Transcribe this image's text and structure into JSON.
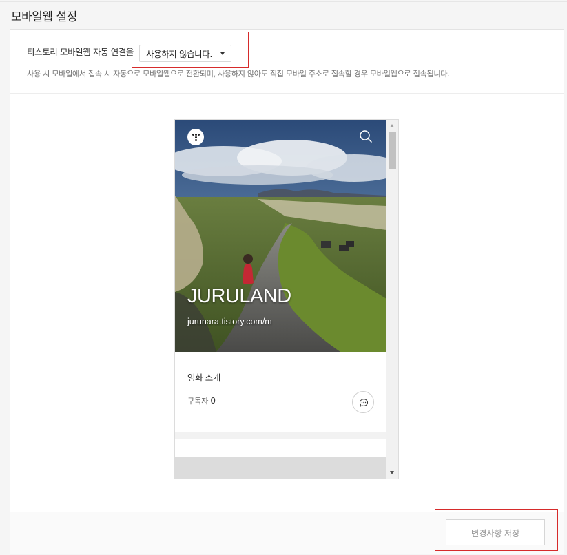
{
  "page": {
    "title": "모바일웹 설정"
  },
  "setting": {
    "label": "티스토리 모바일웹 자동 연결을",
    "select_value": "사용하지 않습니다.",
    "description": "사용 시 모바일에서 접속 시 자동으로 모바일웹으로 전환되며, 사용하지 않아도 직접 모바일 주소로 접속할 경우 모바일웹으로 접속됩니다."
  },
  "preview": {
    "blog_title": "JURULAND",
    "blog_url": "jurunara.tistory.com/m",
    "post_title": "영화 소개",
    "subscribers_label": "구독자",
    "subscribers_count": "0"
  },
  "footer": {
    "save_label": "변경사항 저장"
  },
  "colors": {
    "highlight": "#d62b2b",
    "sky": "#3a5a86",
    "grass": "#5c7a2c"
  }
}
